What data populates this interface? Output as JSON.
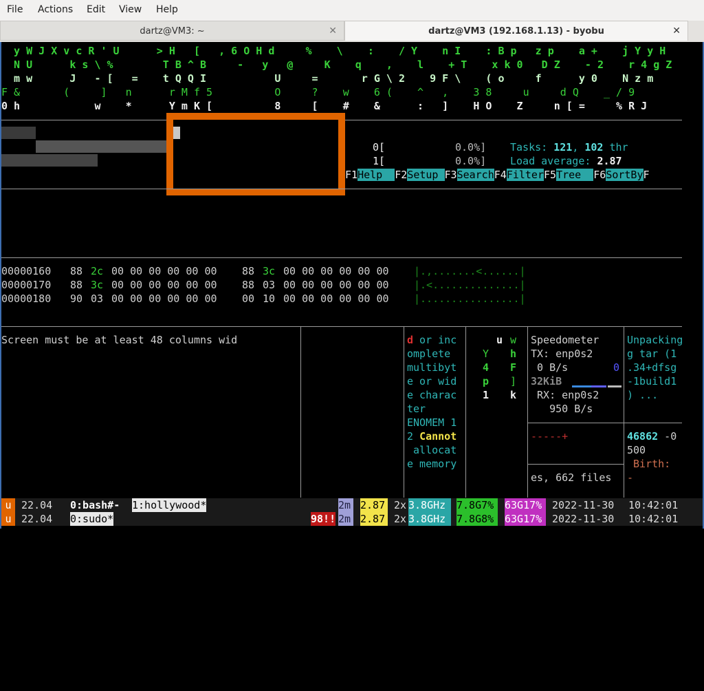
{
  "menu": {
    "file": "File",
    "actions": "Actions",
    "edit": "Edit",
    "view": "View",
    "help": "Help"
  },
  "tabs": [
    {
      "title": "dartz@VM3: ~",
      "close": "✕"
    },
    {
      "title": "dartz@VM3 (192.168.1.13) - byobu",
      "close": "✕"
    }
  ],
  "matrix": {
    "row1": "  y W J X v c R ' U      > H   [   , 6 O H d     %    \\    :    / Y    n I    : B p   z p    a +    j Y y H",
    "row2": "  N U      k s \\ %        T B ^ B     -   y   @     K    q    ,    l    + T    x k 0   D Z    - 2    r 4 g Z",
    "row3": "  m w      J   - [   =    t Q Q I           U     =       r G \\ 2    9 F \\    ( o     f      y 0    N z m",
    "row4": "F &       (     ]   n      r M f 5          O     ?    w    6 (    ^   ,    3 8     u     d Q    _ / 9",
    "row5": "0 h            w    *      Y m K [          8     [    #    &      :   ]    H O    Z     n [ =     % R J"
  },
  "htop": {
    "cpu0_label": "0[",
    "cpu0_val": "0.0%]",
    "cpu1_label": "1[",
    "cpu1_val": "0.0%]",
    "tasks_label": "Tasks: ",
    "tasks_a": "121",
    "tasks_sep": ", ",
    "tasks_b": "102",
    "tasks_thr": " thr",
    "load_label": "Load average: ",
    "load_val": "2.87",
    "fkeys": [
      {
        "num": "F1",
        "label": "Help  "
      },
      {
        "num": "F2",
        "label": "Setup "
      },
      {
        "num": "F3",
        "label": "Search"
      },
      {
        "num": "F4",
        "label": "Filter"
      },
      {
        "num": "F5",
        "label": "Tree  "
      },
      {
        "num": "F6",
        "label": "SortBy"
      },
      {
        "num": "F",
        "label": ""
      }
    ]
  },
  "hexdump": {
    "rows": [
      {
        "addr": "00000160",
        "b1": "88",
        "b2": "2c",
        "b3": "00 00 00 00 00 00",
        "b4": "88",
        "b5": "3c",
        "b6": "00 00 00 00 00 00",
        "ascii": "|.,.......<......|"
      },
      {
        "addr": "00000170",
        "b1": "88",
        "b2": "3c",
        "b3": "00 00 00 00 00 00",
        "b4": "88",
        "b5": "03",
        "b6": "00 00 00 00 00 00",
        "ascii": "|.<..............|"
      },
      {
        "addr": "00000180",
        "b1": "90",
        "b2": "03",
        "b3": "00 00 00 00 00 00",
        "b4": "00",
        "b5": "10",
        "b6": "00 00 00 00 00 00",
        "ascii": "|................|"
      }
    ]
  },
  "panes": {
    "screen_msg": "Screen must be at least 48 columns wid",
    "error_first": "d",
    "error_lines": [
      " or inc",
      "omplete",
      "multibyt",
      "e or wid",
      "e charac",
      "ter",
      "ENOMEM 1",
      "2 "
    ],
    "error_bold": "Cannot",
    "error_tail": [
      " allocat",
      "e memory"
    ],
    "cols": {
      "c1": [
        "",
        "Y",
        "4",
        "p",
        "1"
      ],
      "c2": [
        "u",
        "",
        "",
        "",
        ""
      ],
      "c3": [
        "w",
        "h",
        "F",
        "]",
        "k"
      ]
    },
    "speed": {
      "title": "Speedometer",
      "tx": "TX: enp0s2",
      "tx_rate": " 0 B/s",
      "tx_zero": "0",
      "tx_total": "32KiB",
      "rx": " RX: enp0s2",
      "rx_rate": "   950 B/s",
      "dashes": "-----+",
      "files": "es, 662 files"
    },
    "unpack": {
      "lines": [
        "Unpacking",
        "g tar (1",
        ".34+dfsg",
        "-1build1",
        ") ..."
      ],
      "num": "46862",
      "num_tail": " -0",
      "line2": "500",
      "birth": " Birth:",
      "dash": "-"
    }
  },
  "status": {
    "row1": {
      "u": "u",
      "ver": " 22.04 ",
      "win0": "0:bash#-",
      "sp": " ",
      "win1": "1:hollywood*",
      "m": "2m",
      "load": "2.87",
      "cpus": " 2x",
      "ghz": "3.8GHz",
      "mem": "7.8G7%",
      "disk": "63G17%",
      "date": " 2022-11-30 ",
      "time": "10:42:01"
    },
    "row2": {
      "u": "u",
      "ver": " 22.04 ",
      "win0": "0:sudo*",
      "warn": "98!!",
      "m": "2m",
      "load": "2.87",
      "cpus": " 2x",
      "ghz": "3.8GHz",
      "mem": "7.8G8%",
      "disk": "63G17%",
      "date": " 2022-11-30 ",
      "time": "10:42:01"
    }
  },
  "colors": {
    "accent_blue": "#3d6db0",
    "orange": "#e06400",
    "cyan": "#2aa6a6"
  }
}
